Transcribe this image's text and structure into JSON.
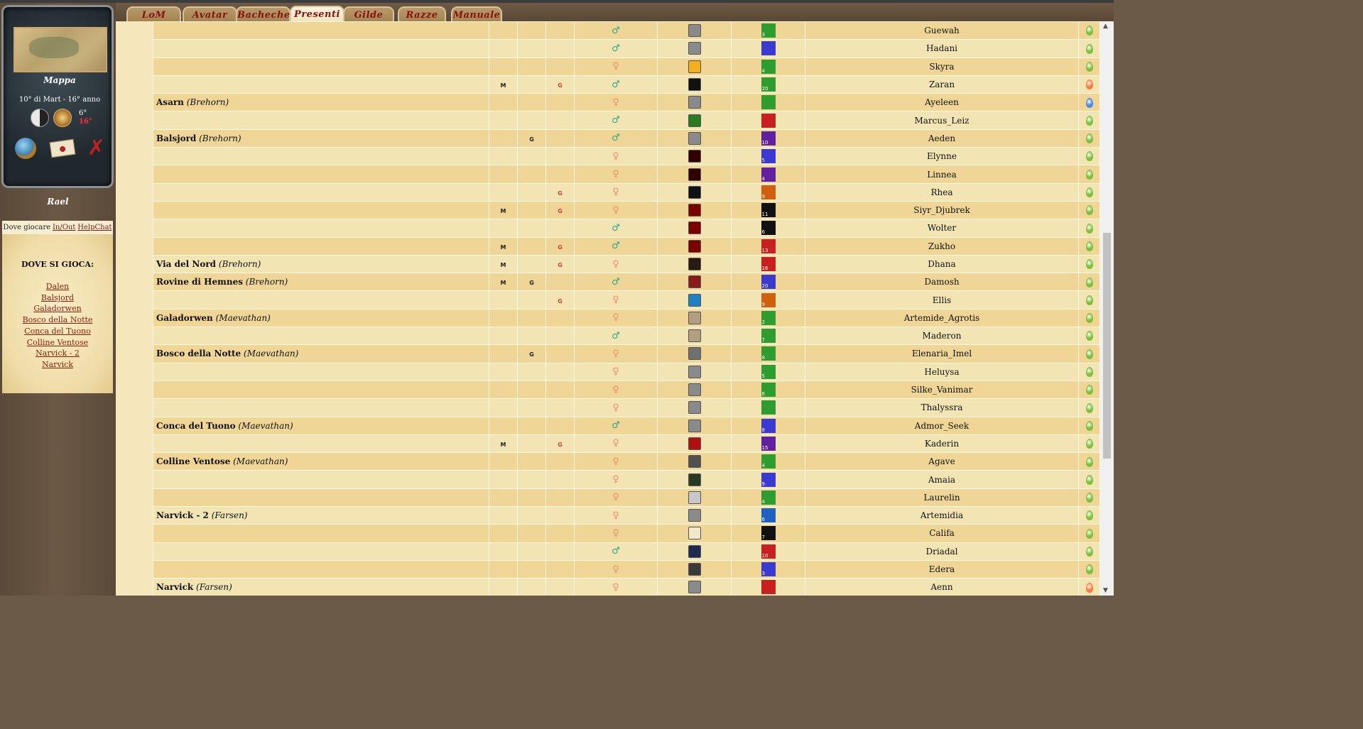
{
  "sidebar": {
    "map_label": "Mappa",
    "date": "10° di Mart - 16° anno",
    "temp_main": "6°",
    "temp_alt": "16°",
    "username": "Rael",
    "tabs": [
      {
        "label": "Dove giocare"
      },
      {
        "label": "In/Out"
      },
      {
        "label": "HelpChat"
      }
    ],
    "heading": "DOVE SI GIOCA:",
    "places": [
      "Dalen",
      "Balsjord",
      "Galadorwen",
      "Bosco della Notte",
      "Conca del Tuono",
      "Colline Ventose",
      "Narvick - 2",
      "Narvick"
    ]
  },
  "nav": {
    "tabs": [
      "LoM",
      "Avatar",
      "Bacheche",
      "Presenti",
      "Gilde",
      "Razze",
      "Manuale"
    ],
    "active": "Presenti"
  },
  "colors": {
    "male": "#2aa88a",
    "female": "#f08c6c",
    "drop_green": "#7fbf3a",
    "drop_orange": "#ff7a3a",
    "drop_blue": "#4a88e0"
  },
  "rows": [
    {
      "place": "",
      "region": "",
      "m": "",
      "g1": "",
      "g2": "",
      "sex": "m",
      "avatar": "#8a8a8a",
      "race": "#2e9c2e",
      "rank": "3",
      "name": "Guewah",
      "drop": "green"
    },
    {
      "place": "",
      "region": "",
      "m": "",
      "g1": "",
      "g2": "",
      "sex": "m",
      "avatar": "#8a8a8a",
      "race": "#3a3ad0",
      "rank": "",
      "name": "Hadani",
      "drop": "green"
    },
    {
      "place": "",
      "region": "",
      "m": "",
      "g1": "",
      "g2": "",
      "sex": "f",
      "avatar": "#f0b020",
      "race": "#2e9c2e",
      "rank": "4",
      "name": "Skyra",
      "drop": "green"
    },
    {
      "place": "",
      "region": "",
      "m": "M",
      "g1": "",
      "g2": "G",
      "sex": "m",
      "avatar": "#111111",
      "race": "#2e9c2e",
      "rank": "20",
      "name": "Zaran",
      "drop": "orange"
    },
    {
      "place": "Asarn",
      "region": "(Brehorn)",
      "m": "",
      "g1": "",
      "g2": "",
      "sex": "f",
      "avatar": "#8a8a8a",
      "race": "#2e9c2e",
      "rank": "",
      "name": "Ayeleen",
      "drop": "blue"
    },
    {
      "place": "",
      "region": "",
      "m": "",
      "g1": "",
      "g2": "",
      "sex": "m",
      "avatar": "#2a7a20",
      "race": "#c82020",
      "rank": "",
      "name": "Marcus_Leiz",
      "drop": "green"
    },
    {
      "place": "Balsjord",
      "region": "(Brehorn)",
      "m": "",
      "g1": "G",
      "g2": "",
      "sex": "m",
      "avatar": "#8a8a8a",
      "race": "#6020a0",
      "rank": "10",
      "name": "Aeden",
      "drop": "green"
    },
    {
      "place": "",
      "region": "",
      "m": "",
      "g1": "",
      "g2": "",
      "sex": "f",
      "avatar": "#300000",
      "race": "#3a3ad0",
      "rank": "5",
      "name": "Elynne",
      "drop": "green"
    },
    {
      "place": "",
      "region": "",
      "m": "",
      "g1": "",
      "g2": "",
      "sex": "f",
      "avatar": "#300000",
      "race": "#6020a0",
      "rank": "4",
      "name": "Linnea",
      "drop": "green"
    },
    {
      "place": "",
      "region": "",
      "m": "",
      "g1": "",
      "g2": "G",
      "sex": "f",
      "avatar": "#111111",
      "race": "#d06010",
      "rank": "9",
      "name": "Rhea",
      "drop": "green"
    },
    {
      "place": "",
      "region": "",
      "m": "M",
      "g1": "",
      "g2": "G",
      "sex": "f",
      "avatar": "#7a0000",
      "race": "#111111",
      "rank": "11",
      "name": "Siyr_Djubrek",
      "drop": "green"
    },
    {
      "place": "",
      "region": "",
      "m": "",
      "g1": "",
      "g2": "",
      "sex": "m",
      "avatar": "#7a0000",
      "race": "#111111",
      "rank": "6",
      "name": "Wolter",
      "drop": "green"
    },
    {
      "place": "",
      "region": "",
      "m": "M",
      "g1": "",
      "g2": "G",
      "sex": "m",
      "avatar": "#7a0000",
      "race": "#c82020",
      "rank": "13",
      "name": "Zukho",
      "drop": "green"
    },
    {
      "place": "Via del Nord",
      "region": "(Brehorn)",
      "m": "M",
      "g1": "",
      "g2": "G",
      "sex": "f",
      "avatar": "#2a1a10",
      "race": "#c82020",
      "rank": "16",
      "name": "Dhana",
      "drop": "green"
    },
    {
      "place": "Rovine di Hemnes",
      "region": "(Brehorn)",
      "m": "M",
      "g1": "G",
      "g2": "",
      "sex": "m",
      "avatar": "#8a1a1a",
      "race": "#3a3ad0",
      "rank": "20",
      "name": "Damosh",
      "drop": "green"
    },
    {
      "place": "",
      "region": "",
      "m": "",
      "g1": "",
      "g2": "G",
      "sex": "f",
      "avatar": "#2080c0",
      "race": "#d06010",
      "rank": "9",
      "name": "Ellis",
      "drop": "green"
    },
    {
      "place": "Galadorwen",
      "region": "(Maevathan)",
      "m": "",
      "g1": "",
      "g2": "",
      "sex": "f",
      "avatar": "#b0a080",
      "race": "#2e9c2e",
      "rank": "2",
      "name": "Artemide_Agrotis",
      "drop": "green"
    },
    {
      "place": "",
      "region": "",
      "m": "",
      "g1": "",
      "g2": "",
      "sex": "m",
      "avatar": "#b0a080",
      "race": "#2e9c2e",
      "rank": "7",
      "name": "Maderon",
      "drop": "green"
    },
    {
      "place": "Bosco della Notte",
      "region": "(Maevathan)",
      "m": "",
      "g1": "G",
      "g2": "",
      "sex": "f",
      "avatar": "#707070",
      "race": "#2e9c2e",
      "rank": "8",
      "name": "Elenaria_Imel",
      "drop": "green"
    },
    {
      "place": "",
      "region": "",
      "m": "",
      "g1": "",
      "g2": "",
      "sex": "f",
      "avatar": "#8a8a8a",
      "race": "#2e9c2e",
      "rank": "5",
      "name": "Heluysa",
      "drop": "green"
    },
    {
      "place": "",
      "region": "",
      "m": "",
      "g1": "",
      "g2": "",
      "sex": "f",
      "avatar": "#8a8a8a",
      "race": "#2e9c2e",
      "rank": "6",
      "name": "Silke_Vanimar",
      "drop": "green"
    },
    {
      "place": "",
      "region": "",
      "m": "",
      "g1": "",
      "g2": "",
      "sex": "f",
      "avatar": "#8a8a8a",
      "race": "#2e9c2e",
      "rank": "",
      "name": "Thalyssra",
      "drop": "green"
    },
    {
      "place": "Conca del Tuono",
      "region": "(Maevathan)",
      "m": "",
      "g1": "",
      "g2": "",
      "sex": "m",
      "avatar": "#8a8a8a",
      "race": "#3a3ad0",
      "rank": "8",
      "name": "Admor_Seek",
      "drop": "green"
    },
    {
      "place": "",
      "region": "",
      "m": "M",
      "g1": "",
      "g2": "G",
      "sex": "f",
      "avatar": "#b01010",
      "race": "#6020a0",
      "rank": "15",
      "name": "Kaderin",
      "drop": "green"
    },
    {
      "place": "Colline Ventose",
      "region": "(Maevathan)",
      "m": "",
      "g1": "",
      "g2": "",
      "sex": "f",
      "avatar": "#505050",
      "race": "#2e9c2e",
      "rank": "4",
      "name": "Agave",
      "drop": "green"
    },
    {
      "place": "",
      "region": "",
      "m": "",
      "g1": "",
      "g2": "",
      "sex": "f",
      "avatar": "#2a3a20",
      "race": "#3a3ad0",
      "rank": "9",
      "name": "Amaia",
      "drop": "green"
    },
    {
      "place": "",
      "region": "",
      "m": "",
      "g1": "",
      "g2": "",
      "sex": "f",
      "avatar": "#c8c8c8",
      "race": "#2e9c2e",
      "rank": "4",
      "name": "Laurelin",
      "drop": "green"
    },
    {
      "place": "Narvick - 2",
      "region": "(Farsen)",
      "m": "",
      "g1": "",
      "g2": "",
      "sex": "f",
      "avatar": "#8a8a8a",
      "race": "#2060c0",
      "rank": "6",
      "name": "Artemidia",
      "drop": "green"
    },
    {
      "place": "",
      "region": "",
      "m": "",
      "g1": "",
      "g2": "",
      "sex": "f",
      "avatar": "#f0e8c8",
      "race": "#111111",
      "rank": "7",
      "name": "Califa",
      "drop": "green"
    },
    {
      "place": "",
      "region": "",
      "m": "",
      "g1": "",
      "g2": "",
      "sex": "m",
      "avatar": "#202a50",
      "race": "#c82020",
      "rank": "10",
      "name": "Driadal",
      "drop": "green"
    },
    {
      "place": "",
      "region": "",
      "m": "",
      "g1": "",
      "g2": "",
      "sex": "f",
      "avatar": "#3a3a3a",
      "race": "#3a3ad0",
      "rank": "3",
      "name": "Edera",
      "drop": "green"
    },
    {
      "place": "Narvick",
      "region": "(Farsen)",
      "m": "",
      "g1": "",
      "g2": "",
      "sex": "f",
      "avatar": "#8a8a8a",
      "race": "#c82020",
      "rank": "",
      "name": "Aenn",
      "drop": "orange"
    }
  ]
}
